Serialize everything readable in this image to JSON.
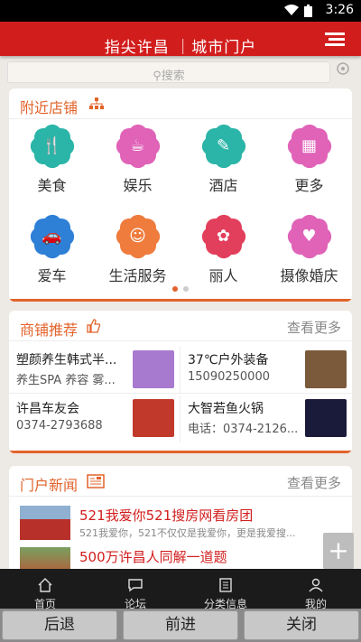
{
  "status_bar": {
    "time": "3:26"
  },
  "header": {
    "title": "指尖许昌 ｜城市门户"
  },
  "search": {
    "placeholder": "搜索"
  },
  "nearby": {
    "title": "附近店铺",
    "items": [
      {
        "label": "美食",
        "icon": "food-icon",
        "color": "#2bb5a8",
        "glyph": "🍴"
      },
      {
        "label": "娱乐",
        "icon": "cup-icon",
        "color": "#e063b8",
        "glyph": "☕"
      },
      {
        "label": "酒店",
        "icon": "hotel-icon",
        "color": "#2bb5a8",
        "glyph": "✎"
      },
      {
        "label": "更多",
        "icon": "more-grid-icon",
        "color": "#e063b8",
        "glyph": "▦"
      },
      {
        "label": "爱车",
        "icon": "car-icon",
        "color": "#2e7fd6",
        "glyph": "🚗"
      },
      {
        "label": "生活服务",
        "icon": "service-icon",
        "color": "#ef7b3c",
        "glyph": "☺"
      },
      {
        "label": "丽人",
        "icon": "beauty-icon",
        "color": "#e23f5c",
        "glyph": "✿"
      },
      {
        "label": "摄像婚庆",
        "icon": "wedding-icon",
        "color": "#e063b8",
        "glyph": "♥"
      }
    ],
    "page_dots": 2,
    "active_dot": 0
  },
  "shops": {
    "title": "商铺推荐",
    "more": "查看更多",
    "items": [
      {
        "name": "塑颜养生韩式半...",
        "sub": "养生SPA 养容 雾...",
        "thumb_color": "#a77ad0"
      },
      {
        "name": "37℃户外装备",
        "sub": "15090250000",
        "thumb_color": "#7a5a3a"
      },
      {
        "name": "许昌车友会",
        "sub": "0374-2793688",
        "thumb_color": "#c0392b"
      },
      {
        "name": "大智若鱼火锅",
        "sub": "电话：0374-2126...",
        "thumb_color": "#1a1a3a"
      }
    ]
  },
  "news": {
    "title": "门户新闻",
    "more": "查看更多",
    "items": [
      {
        "title": "521我爱你521搜房网看房团",
        "desc": "521我爱你，521不仅仅是我爱你，更是我爱搜..."
      },
      {
        "title": "500万许昌人同解一道题",
        "desc": ""
      }
    ]
  },
  "fab": {
    "label": "+"
  },
  "tabbar": {
    "items": [
      {
        "label": "首页",
        "icon": "home-icon"
      },
      {
        "label": "论坛",
        "icon": "forum-icon"
      },
      {
        "label": "分类信息",
        "icon": "category-icon"
      },
      {
        "label": "我的",
        "icon": "user-icon"
      }
    ]
  },
  "browser": {
    "back": "后退",
    "forward": "前进",
    "close": "关闭"
  },
  "colors": {
    "brand_red": "#d21d1d",
    "accent_orange": "#e2632a"
  }
}
